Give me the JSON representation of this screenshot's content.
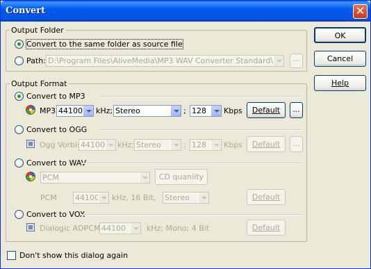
{
  "window": {
    "title": "Convert",
    "close_glyph": "✕"
  },
  "output_folder": {
    "title": "Output Folder",
    "same_folder_label": "Convert to the same folder as source file",
    "path_label": "Path:",
    "path_value": "D:\\Program Files\\AliveMedia\\MP3 WAV Converter Standard\\",
    "browse_label": "..."
  },
  "output_format": {
    "title": "Output Format",
    "mp3": {
      "label": "Convert to MP3",
      "format_name": "MP3",
      "rate": "44100",
      "rate_unit": "kHz;",
      "channels": "Stereo",
      "sep": ";",
      "bitrate": "128",
      "bitrate_unit": "Kbps",
      "default_label": "Default",
      "more_label": "..."
    },
    "ogg": {
      "label": "Convert to OGG",
      "format_name": "Ogg Vorbis",
      "rate": "44100",
      "rate_unit": "kHz;",
      "channels": "Stereo",
      "sep": ";",
      "bitrate": "128",
      "bitrate_unit": "Kbps",
      "default_label": "Default",
      "more_label": "..."
    },
    "wav": {
      "label": "Convert to WAV",
      "codec": "PCM",
      "cd_quality_label": "CD quanlity",
      "pcm_label": "PCM",
      "rate": "44100",
      "rate_unit": "kHz, 16 Bit,",
      "channels": "Stereo",
      "default_label": "Default"
    },
    "vox": {
      "label": "Convert to VOX",
      "format_name": "Dialogic ADPCM",
      "rate": "44100",
      "details": "kHz; Mono; 4 Bit",
      "default_label": "Default"
    }
  },
  "buttons": {
    "ok": "OK",
    "cancel": "Cancel",
    "help": "Help"
  },
  "footer": {
    "dont_show_label": "Don't show this dialog again"
  },
  "colors": {
    "accent_radio": "#21a121",
    "title_bar": "#0054e3",
    "dialog_bg": "#ece9d8"
  }
}
